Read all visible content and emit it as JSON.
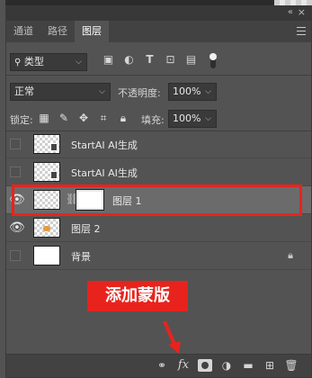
{
  "panel": {
    "tabs": [
      {
        "label": "通道",
        "active": false
      },
      {
        "label": "路径",
        "active": false
      },
      {
        "label": "图层",
        "active": true
      }
    ],
    "collapse_icon": "double-chevron-icon",
    "close_icon": "close-icon"
  },
  "filter": {
    "kind_label": "类型",
    "icons": [
      "image-filter-icon",
      "adjustment-filter-icon",
      "type-filter-icon",
      "shape-filter-icon",
      "smart-object-filter-icon"
    ]
  },
  "blend": {
    "mode": "正常",
    "opacity_label": "不透明度:",
    "opacity_value": "100%"
  },
  "lock": {
    "label": "锁定:",
    "fill_label": "填充:",
    "fill_value": "100%"
  },
  "layers": [
    {
      "name": "StartAI AI生成",
      "visible": false,
      "thumb": "transparent",
      "smart": true
    },
    {
      "name": "StartAI AI生成",
      "visible": false,
      "thumb": "transparent",
      "smart": true
    },
    {
      "name": "图层 1",
      "visible": true,
      "thumb": "transparent",
      "mask": true,
      "selected": true
    },
    {
      "name": "图层 2",
      "visible": true,
      "thumb": "transparent"
    },
    {
      "name": "背景",
      "visible": false,
      "thumb": "white",
      "locked": true
    }
  ],
  "annotation": {
    "text": "添加蒙版",
    "color": "#e8231d"
  },
  "bottom_icons": [
    "link-icon",
    "fx-icon",
    "add-mask-icon",
    "adjustment-layer-icon",
    "folder-icon",
    "new-layer-icon",
    "trash-icon"
  ],
  "bottom": {
    "fx_label": "fx"
  }
}
